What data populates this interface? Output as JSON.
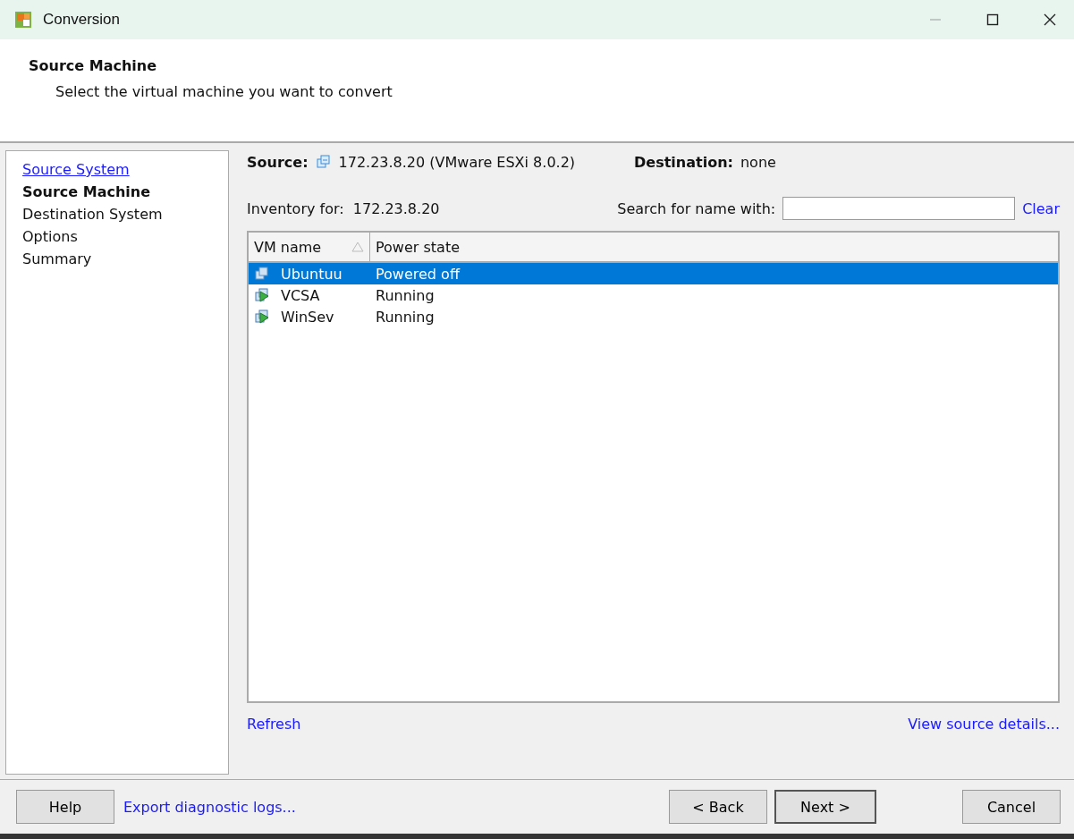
{
  "window": {
    "title": "Conversion"
  },
  "header": {
    "title": "Source Machine",
    "subtitle": "Select the virtual machine you want to convert"
  },
  "steps": [
    {
      "label": "Source System",
      "kind": "link"
    },
    {
      "label": "Source Machine",
      "kind": "current"
    },
    {
      "label": "Destination System",
      "kind": "pending"
    },
    {
      "label": "Options",
      "kind": "pending"
    },
    {
      "label": "Summary",
      "kind": "pending"
    }
  ],
  "source": {
    "label": "Source:",
    "value": "172.23.8.20 (VMware ESXi 8.0.2)"
  },
  "destination": {
    "label": "Destination:",
    "value": "none"
  },
  "inventory": "Inventory for:  172.23.8.20",
  "search": {
    "label": "Search for name with:",
    "clear": "Clear"
  },
  "table": {
    "columns": [
      "VM name",
      "Power state"
    ],
    "rows": [
      {
        "name": "Ubuntuu",
        "state": "Powered off",
        "kind": "off",
        "selected": true
      },
      {
        "name": "VCSA",
        "state": "Running",
        "kind": "on",
        "selected": false
      },
      {
        "name": "WinSev",
        "state": "Running",
        "kind": "on",
        "selected": false
      }
    ]
  },
  "refresh": "Refresh",
  "details": "View source details...",
  "footer": {
    "help": "Help",
    "export": "Export diagnostic logs...",
    "back": "< Back",
    "next": "Next >",
    "cancel": "Cancel"
  }
}
